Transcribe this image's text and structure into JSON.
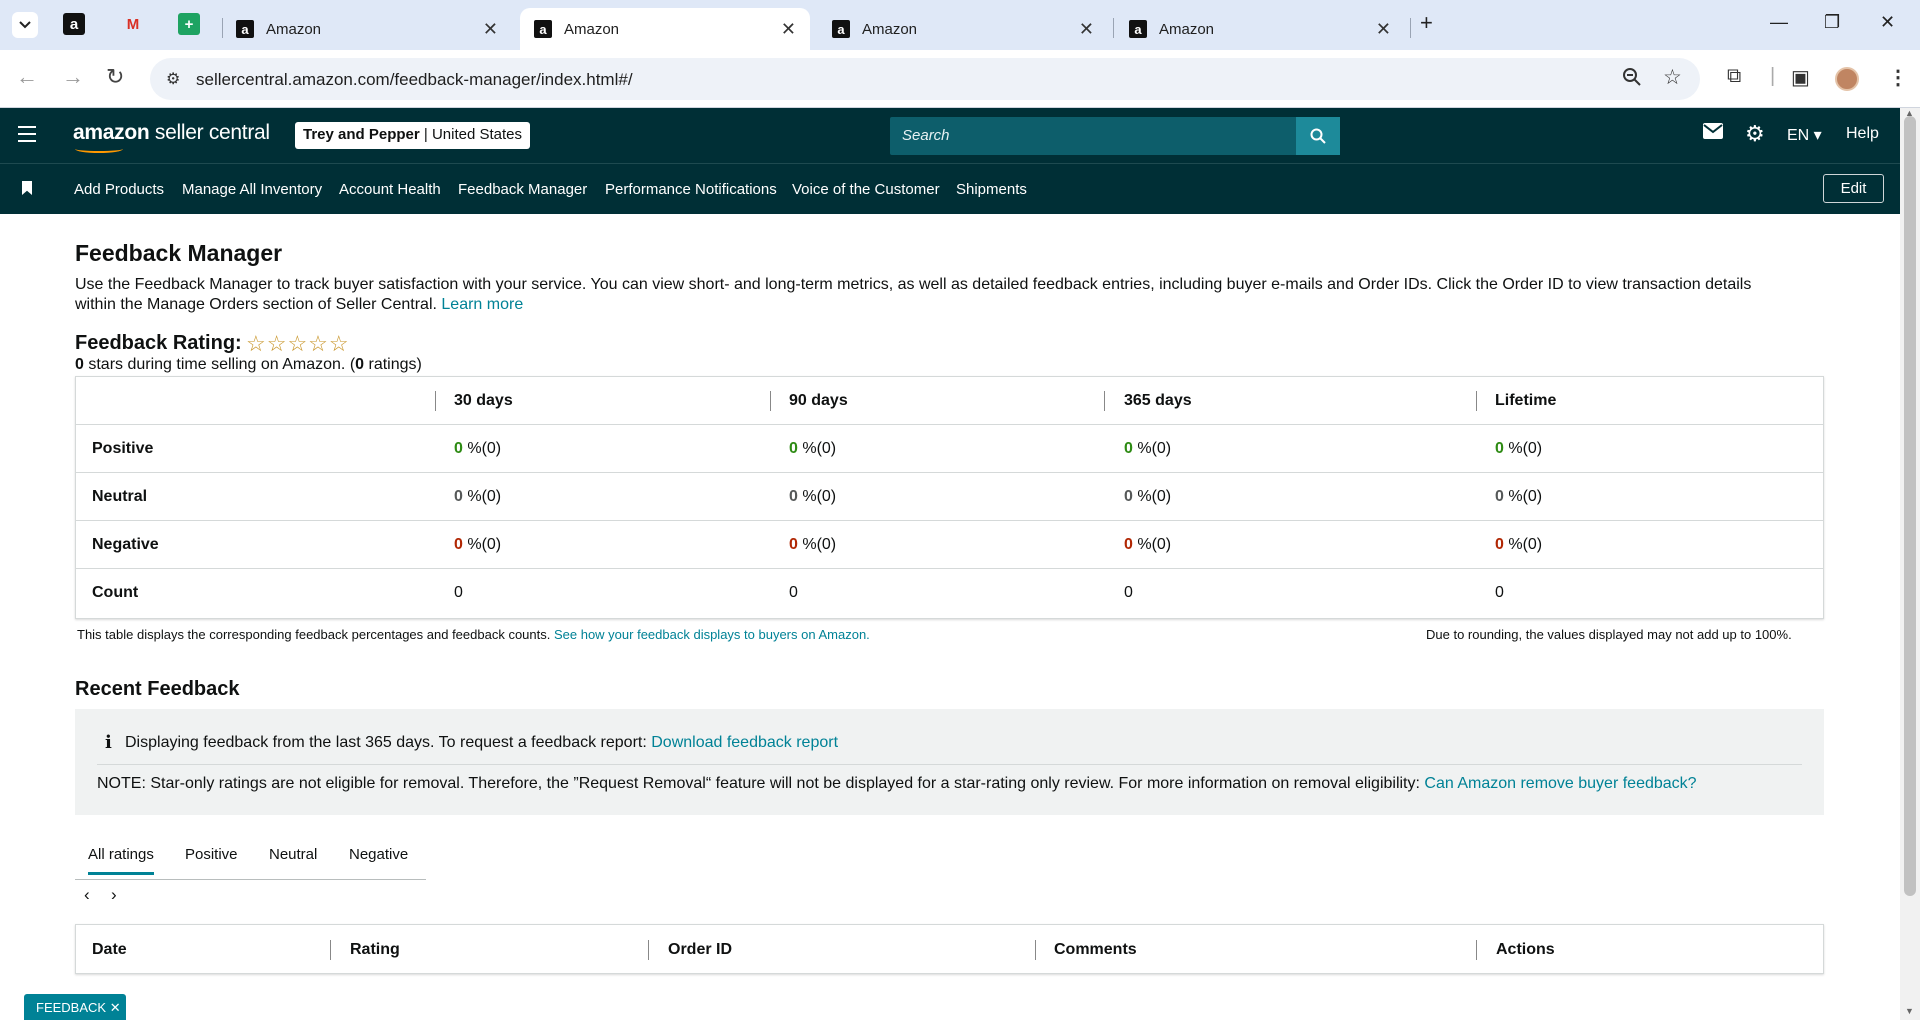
{
  "browser": {
    "tabs": [
      {
        "label": "Amazon"
      },
      {
        "label": "Amazon"
      },
      {
        "label": "Amazon"
      },
      {
        "label": "Amazon"
      }
    ],
    "url": "sellercentral.amazon.com/feedback-manager/index.html#/"
  },
  "header": {
    "logo_bold": "amazon",
    "logo_rest": " seller central",
    "store_name": "Trey and Pepper",
    "store_region": "United States",
    "search_placeholder": "Search",
    "language": "EN",
    "help": "Help"
  },
  "nav": {
    "items": [
      "Add Products",
      "Manage All Inventory",
      "Account Health",
      "Feedback Manager",
      "Performance Notifications",
      "Voice of the Customer",
      "Shipments"
    ],
    "edit": "Edit"
  },
  "page": {
    "title": "Feedback Manager",
    "description": "Use the Feedback Manager to track buyer satisfaction with your service. You can view short- and long-term metrics, as well as detailed feedback entries, including buyer e-mails and Order IDs. Click the Order ID to view transaction details within the Manage Orders section of Seller Central.",
    "learn_more": "Learn more",
    "rating_label": "Feedback Rating:",
    "stars": "☆☆☆☆☆",
    "stars_count": "0",
    "stars_text": " stars during time selling on Amazon. (",
    "ratings_count": "0",
    "ratings_text": " ratings)"
  },
  "metrics": {
    "columns": [
      "30 days",
      "90 days",
      "365 days",
      "Lifetime"
    ],
    "rows": [
      {
        "label": "Positive",
        "values": [
          "0",
          "0",
          "0",
          "0"
        ],
        "suffix": " %(0)"
      },
      {
        "label": "Neutral",
        "values": [
          "0",
          "0",
          "0",
          "0"
        ],
        "suffix": " %(0)"
      },
      {
        "label": "Negative",
        "values": [
          "0",
          "0",
          "0",
          "0"
        ],
        "suffix": " %(0)"
      },
      {
        "label": "Count",
        "values": [
          "0",
          "0",
          "0",
          "0"
        ],
        "suffix": ""
      }
    ],
    "footnote": "This table displays the corresponding feedback percentages and feedback counts.",
    "footnote_link": "See how your feedback displays to buyers on Amazon.",
    "rounding_note": "Due to rounding, the values displayed may not add up to 100%."
  },
  "recent": {
    "title": "Recent Feedback",
    "info_text": "Displaying feedback from the last 365 days. To request a feedback report:",
    "download_link": "Download feedback report",
    "note": "NOTE: Star-only ratings are not eligible for removal. Therefore, the ”Request Removal“ feature will not be displayed for a star-rating only review. For more information on removal eligibility:",
    "note_link": "Can Amazon remove buyer feedback?",
    "tabs": [
      "All ratings",
      "Positive",
      "Neutral",
      "Negative"
    ],
    "table_headers": [
      "Date",
      "Rating",
      "Order ID",
      "Comments",
      "Actions"
    ]
  },
  "feedback_chip": "FEEDBACK"
}
